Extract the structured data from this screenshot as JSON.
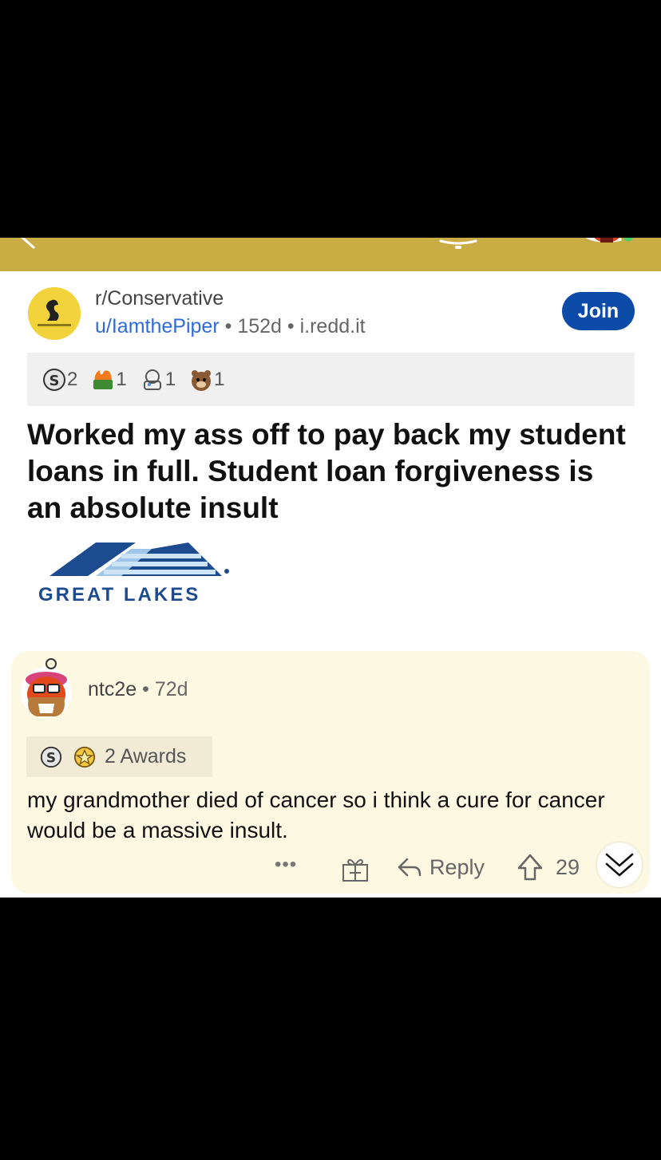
{
  "post": {
    "subreddit": "r/Conservative",
    "author": "u/IamthePiper",
    "sep1": "•",
    "age": "152d",
    "sep2": "•",
    "domain": "i.redd.it",
    "join_label": "Join",
    "awards": [
      {
        "icon": "silver-award-icon",
        "count": "2"
      },
      {
        "icon": "fire-money-award-icon",
        "count": "1"
      },
      {
        "icon": "bear-doll-award-icon",
        "count": "1"
      },
      {
        "icon": "bear-face-award-icon",
        "count": "1"
      }
    ],
    "title": "Worked my ass off to pay back my student loans in full. Student loan forgiveness is an absolute insult",
    "thumbnail_text": "GREAT LAKES"
  },
  "comment": {
    "author": "ntc2e",
    "sep": "•",
    "age": "72d",
    "awards_label": "2 Awards",
    "body": "my grandmother died of cancer so i think a cure for cancer would be a massive insult.",
    "more_label": "•••",
    "reply_label": "Reply",
    "score": "29"
  },
  "colors": {
    "topbar": "#c9ad44",
    "join_button": "#0d4ba8",
    "author_link": "#2f6bd8",
    "comment_bg": "#fdf8e2"
  }
}
